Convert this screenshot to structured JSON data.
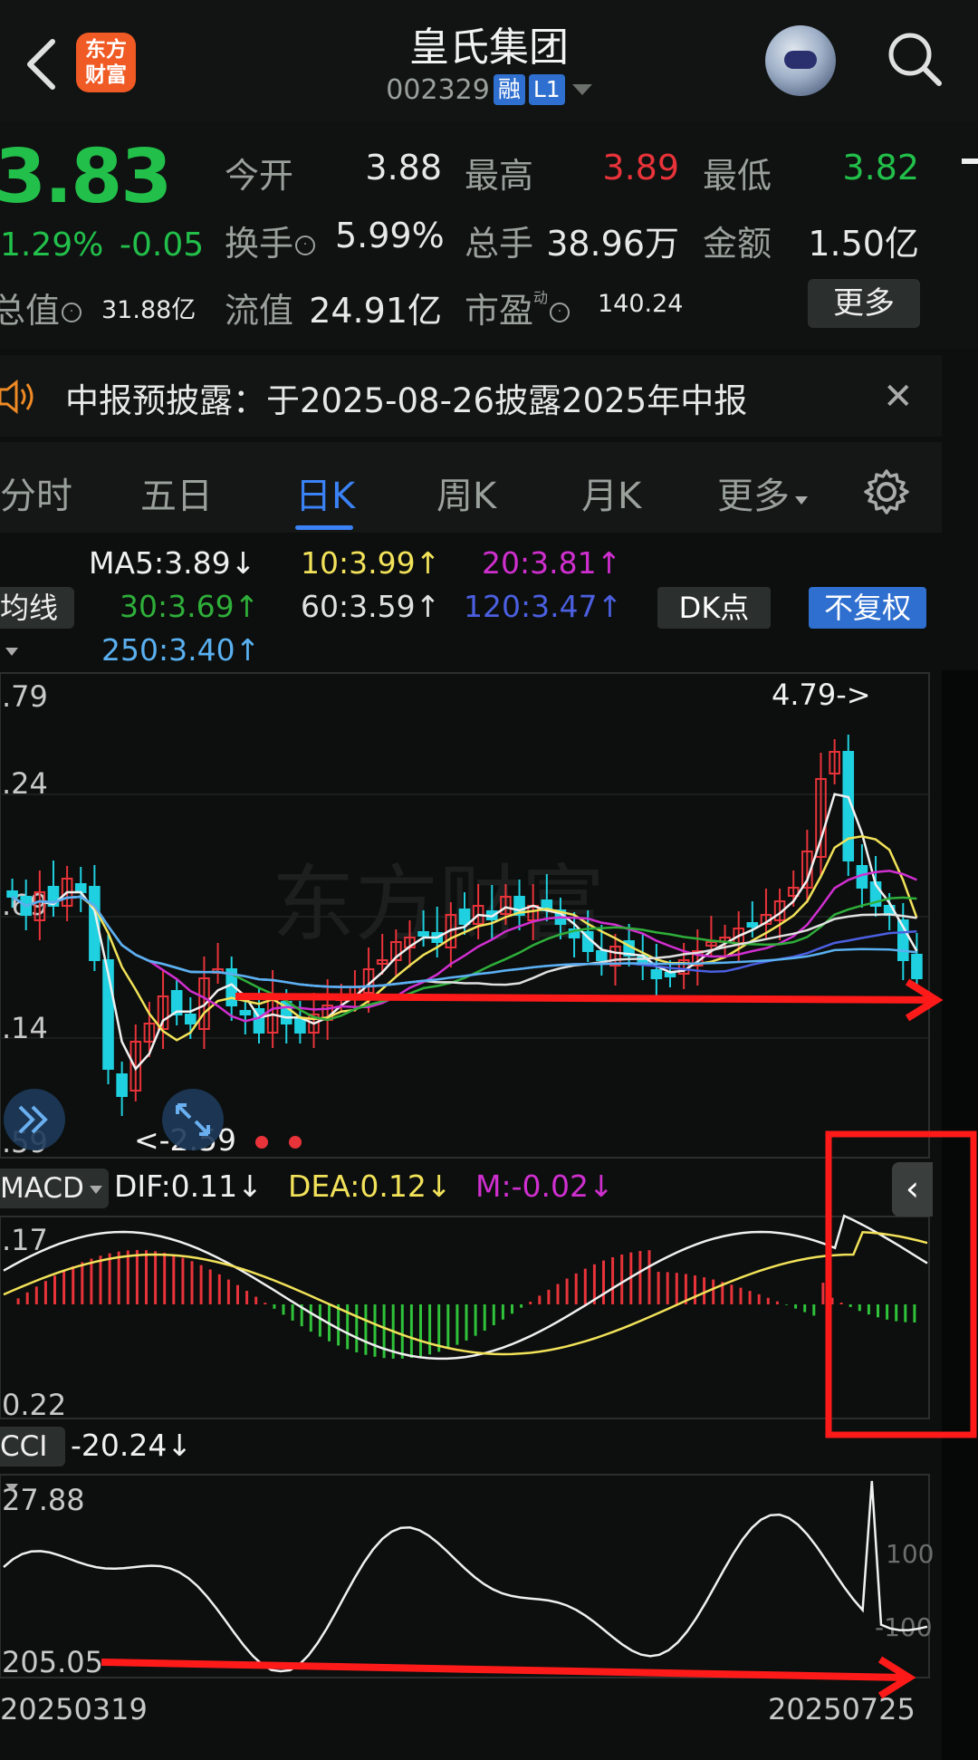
{
  "header": {
    "back_icon": "chevron-left-icon",
    "logo_text_line1": "东方",
    "logo_text_line2": "财富",
    "stock_name": "皇氏集团",
    "stock_code": "002329",
    "badge_margin": "融",
    "badge_level": "L1",
    "search_icon": "search-icon"
  },
  "quote": {
    "price": "3.83",
    "change_pct": "1.29%",
    "change_amt": "-0.05",
    "open_label": "今开",
    "open": "3.88",
    "high_label": "最高",
    "high": "3.89",
    "low_label": "最低",
    "low": "3.82",
    "turnover_label": "换手",
    "turnover": "5.99%",
    "volume_label": "总手",
    "volume": "38.96万",
    "amount_label": "金额",
    "amount": "1.50亿",
    "mcap_label": "总值",
    "mcap": "31.88亿",
    "float_label": "流值",
    "float_cap": "24.91亿",
    "pe_label": "市盈",
    "pe_sup": "动",
    "pe": "140.24",
    "more_label": "更多",
    "colors": {
      "up": "#e8333a",
      "down": "#22c04a"
    }
  },
  "notice": {
    "speaker_icon": "speaker-icon",
    "text": "中报预披露：于2025-08-26披露2025年中报",
    "close_icon": "close-icon"
  },
  "tabs": {
    "items": [
      "分时",
      "五日",
      "日K",
      "周K",
      "月K",
      "更多"
    ],
    "active": "日K",
    "settings_icon": "gear-icon"
  },
  "ma_bar": {
    "select_label": "均线",
    "ma5": "MA5:3.89↓",
    "ma10": "10:3.99↑",
    "ma20": "20:3.81↑",
    "ma30": "30:3.69↑",
    "ma60": "60:3.59↑",
    "ma120": "120:3.47↑",
    "ma250": "250:3.40↑",
    "dk_label": "DK点",
    "fq_label": "不复权"
  },
  "kline": {
    "y_labels": [
      ".79",
      ".24",
      ".69",
      ".14",
      ".59"
    ],
    "peak_label": "4.79->",
    "low_label": "<-2.59"
  },
  "macd": {
    "select_label": "MACD",
    "dif": "DIF:0.11↓",
    "dea": "DEA:0.12↓",
    "m": "M:-0.02↓",
    "y_top": ".17",
    "y_bottom": "0.22",
    "collapse_icon": "chevron-left-icon"
  },
  "cci": {
    "select_label": "CCI",
    "value": "-20.24↓",
    "y_top": "27.88",
    "y_bottom": "205.05",
    "level_high": "100",
    "level_low": "-100",
    "date_start": "20250319",
    "date_end": "20250725"
  }
}
